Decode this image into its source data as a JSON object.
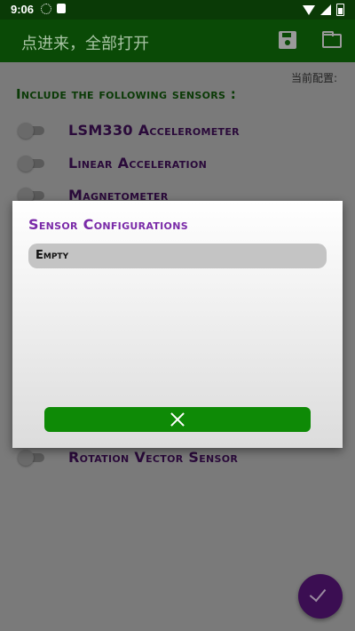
{
  "status_bar": {
    "time": "9:06"
  },
  "toolbar": {
    "title": "点进来，全部打开",
    "save_icon": "save-icon",
    "folder_icon": "folder-icon"
  },
  "main": {
    "current_config_label": "当前配置:",
    "section_title": "Include the following sensors :",
    "sensors": [
      {
        "label": "LSM330 Accelerometer",
        "enabled": false
      },
      {
        "label": "Linear Acceleration",
        "enabled": false
      },
      {
        "label": "Magnetometer",
        "enabled": false
      },
      {
        "label": "Rotation Vector Sensor",
        "enabled": false
      }
    ]
  },
  "dialog": {
    "title": "Sensor Configurations",
    "items": [
      {
        "label": "Empty"
      }
    ],
    "close_icon": "close-icon"
  },
  "fab": {
    "icon": "check-icon"
  },
  "colors": {
    "toolbar": "#0a4a06",
    "accent_green": "#0e8a06",
    "dialog_title": "#7a2aa8",
    "fab": "#3b0e52"
  }
}
